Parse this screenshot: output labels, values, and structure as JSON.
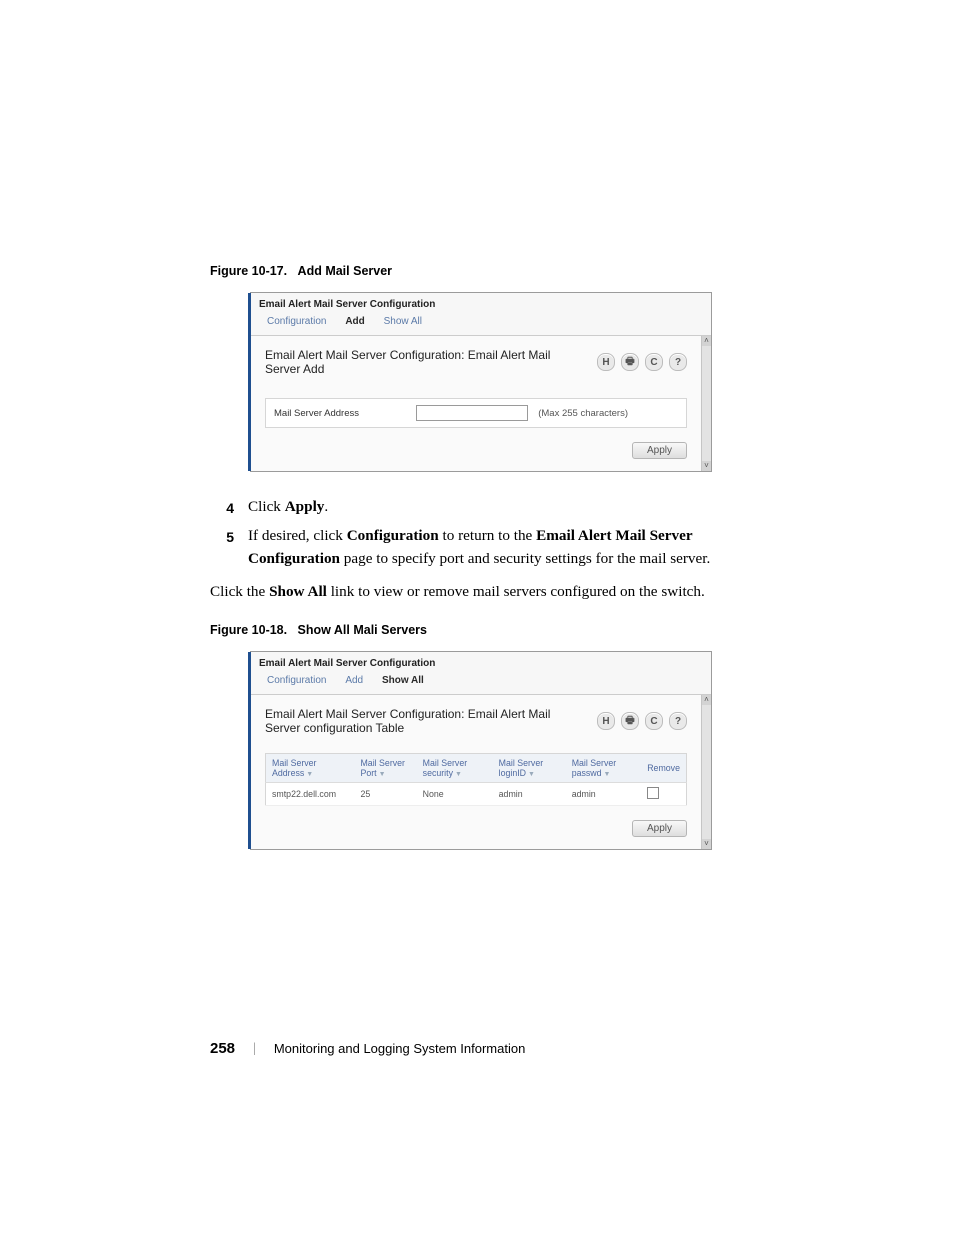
{
  "figure17": {
    "caption_prefix": "Figure 10-17.",
    "caption_title": "Add Mail Server",
    "window_title": "Email Alert Mail Server Configuration",
    "tabs": [
      "Configuration",
      "Add",
      "Show All"
    ],
    "active_tab_index": 1,
    "heading": "Email Alert Mail Server Configuration: Email Alert Mail Server Add",
    "field_label": "Mail Server Address",
    "field_hint": "(Max 255 characters)",
    "apply_label": "Apply"
  },
  "steps": [
    {
      "n": "4",
      "html_parts": [
        "Click ",
        {
          "b": "Apply"
        },
        "."
      ]
    },
    {
      "n": "5",
      "html_parts": [
        "If desired, click ",
        {
          "b": "Configuration"
        },
        " to return to the ",
        {
          "b": "Email Alert Mail Server Configuration"
        },
        " page to specify port and security settings for the mail server."
      ]
    }
  ],
  "paragraph_parts": [
    "Click the ",
    {
      "b": "Show All"
    },
    " link to view or remove mail servers configured on the switch."
  ],
  "figure18": {
    "caption_prefix": "Figure 10-18.",
    "caption_title": "Show All Mali Servers",
    "window_title": "Email Alert Mail Server Configuration",
    "tabs": [
      "Configuration",
      "Add",
      "Show All"
    ],
    "active_tab_index": 2,
    "heading": "Email Alert Mail Server Configuration: Email Alert Mail Server configuration Table",
    "columns": [
      "Mail Server Address",
      "Mail Server Port",
      "Mail Server security",
      "Mail Server loginID",
      "Mail Server passwd",
      "Remove"
    ],
    "rows": [
      {
        "address": "smtp22.dell.com",
        "port": "25",
        "security": "None",
        "login": "admin",
        "passwd": "admin",
        "remove": false
      }
    ],
    "apply_label": "Apply"
  },
  "icons": {
    "save": "H",
    "print": "🖶",
    "refresh": "C",
    "help": "?"
  },
  "footer": {
    "page": "258",
    "section": "Monitoring and Logging System Information"
  }
}
